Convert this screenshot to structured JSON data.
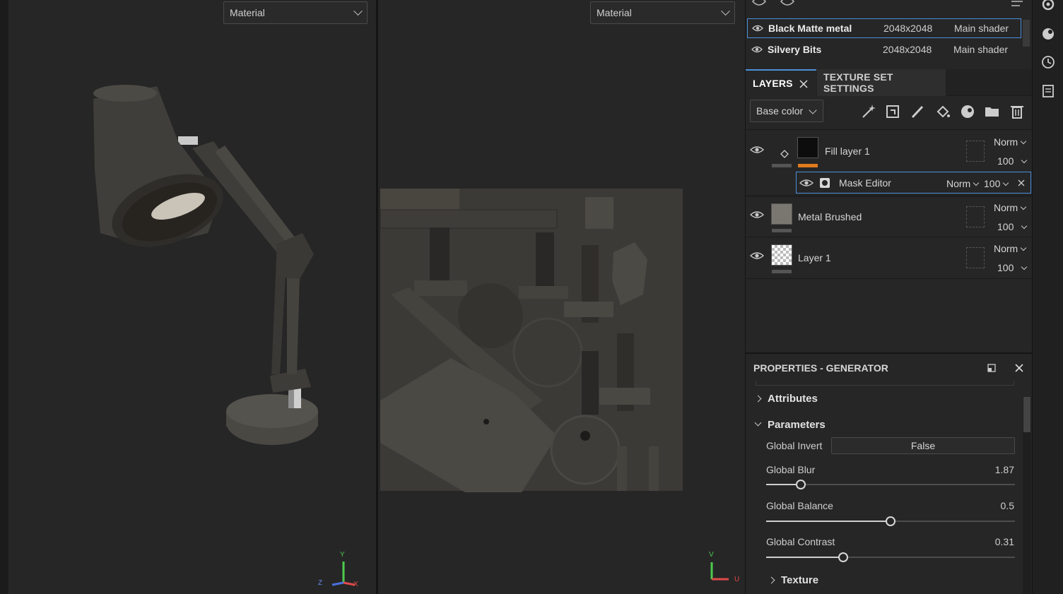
{
  "viewport3d": {
    "mode_label": "Material",
    "axis": {
      "y": "Y",
      "z": "Z",
      "x": "X"
    }
  },
  "viewport2d": {
    "mode_label": "Material",
    "axis": {
      "v": "V",
      "u": "U"
    }
  },
  "texture_sets": [
    {
      "name": "Black Matte metal",
      "resolution": "2048x2048",
      "shader": "Main shader",
      "selected": true
    },
    {
      "name": "Silvery Bits",
      "resolution": "2048x2048",
      "shader": "Main shader",
      "selected": false
    }
  ],
  "tabs": {
    "layers": "LAYERS",
    "texture_set_settings": "TEXTURE SET SETTINGS"
  },
  "toolbar": {
    "channel": "Base color",
    "tools": [
      "magic-wand-icon",
      "effect-icon",
      "paint-brush-icon",
      "fill-bucket-icon",
      "smart-material-icon",
      "folder-icon",
      "trash-icon"
    ]
  },
  "layers": [
    {
      "name": "Fill layer 1",
      "blend": "Norm",
      "opacity": "100",
      "type": "fill"
    },
    {
      "name": "Metal Brushed",
      "blend": "Norm",
      "opacity": "100",
      "type": "material"
    },
    {
      "name": "Layer 1",
      "blend": "Norm",
      "opacity": "100",
      "type": "paint"
    }
  ],
  "mask": {
    "name": "Mask Editor",
    "blend": "Norm",
    "opacity": "100"
  },
  "properties": {
    "title": "PROPERTIES - GENERATOR",
    "sections": {
      "attributes": "Attributes",
      "parameters": "Parameters",
      "texture": "Texture"
    },
    "global_invert": {
      "label": "Global Invert",
      "value": "False"
    },
    "global_blur": {
      "label": "Global Blur",
      "value": "1.87",
      "fraction": 0.14
    },
    "global_balance": {
      "label": "Global Balance",
      "value": "0.5",
      "fraction": 0.5
    },
    "global_contrast": {
      "label": "Global Contrast",
      "value": "0.31",
      "fraction": 0.31
    }
  },
  "colors": {
    "accent": "#4a90d9",
    "fill_layer_tag": "#e07a1f"
  }
}
